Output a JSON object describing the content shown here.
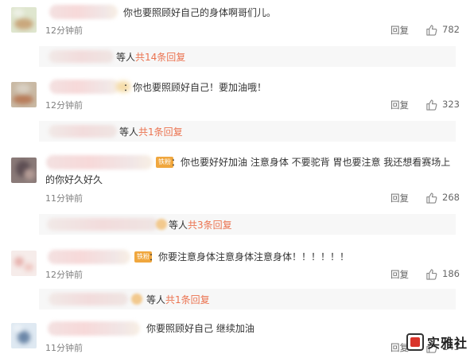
{
  "comments": [
    {
      "text": "你也要照顾好自己的身体啊哥们儿。",
      "time": "12分钟前",
      "reply_label": "回复",
      "likes": "782",
      "sub": {
        "prefix": "等人",
        "link": "共14条回复"
      }
    },
    {
      "text": "：你也要照顾好自己！要加油哦！",
      "time": "12分钟前",
      "reply_label": "回复",
      "likes": "323",
      "sub": {
        "prefix": "等人",
        "link": "共1条回复"
      }
    },
    {
      "badge": "铁粉",
      "text": "：你也要好好加油 注意身体 不要驼背 胃也要注意 我还想看赛场上",
      "text_line2": "的你好久好久",
      "time": "11分钟前",
      "reply_label": "回复",
      "likes": "268",
      "sub": {
        "prefix": "等人",
        "link": "共3条回复"
      }
    },
    {
      "badge": "铁粉",
      "text": "：你要注意身体注意身体注意身体！！！！！！",
      "time": "12分钟前",
      "reply_label": "回复",
      "likes": "186",
      "sub": {
        "prefix": "等人",
        "link": "共1条回复"
      }
    },
    {
      "text": "你要照顾好自己 继续加油",
      "time": "11分钟前",
      "reply_label": "回复",
      "likes": "143"
    }
  ],
  "watermark": "实雅社",
  "colors": {
    "link": "#eb7350",
    "badge": "#f0a73e",
    "meta": "#808080"
  }
}
